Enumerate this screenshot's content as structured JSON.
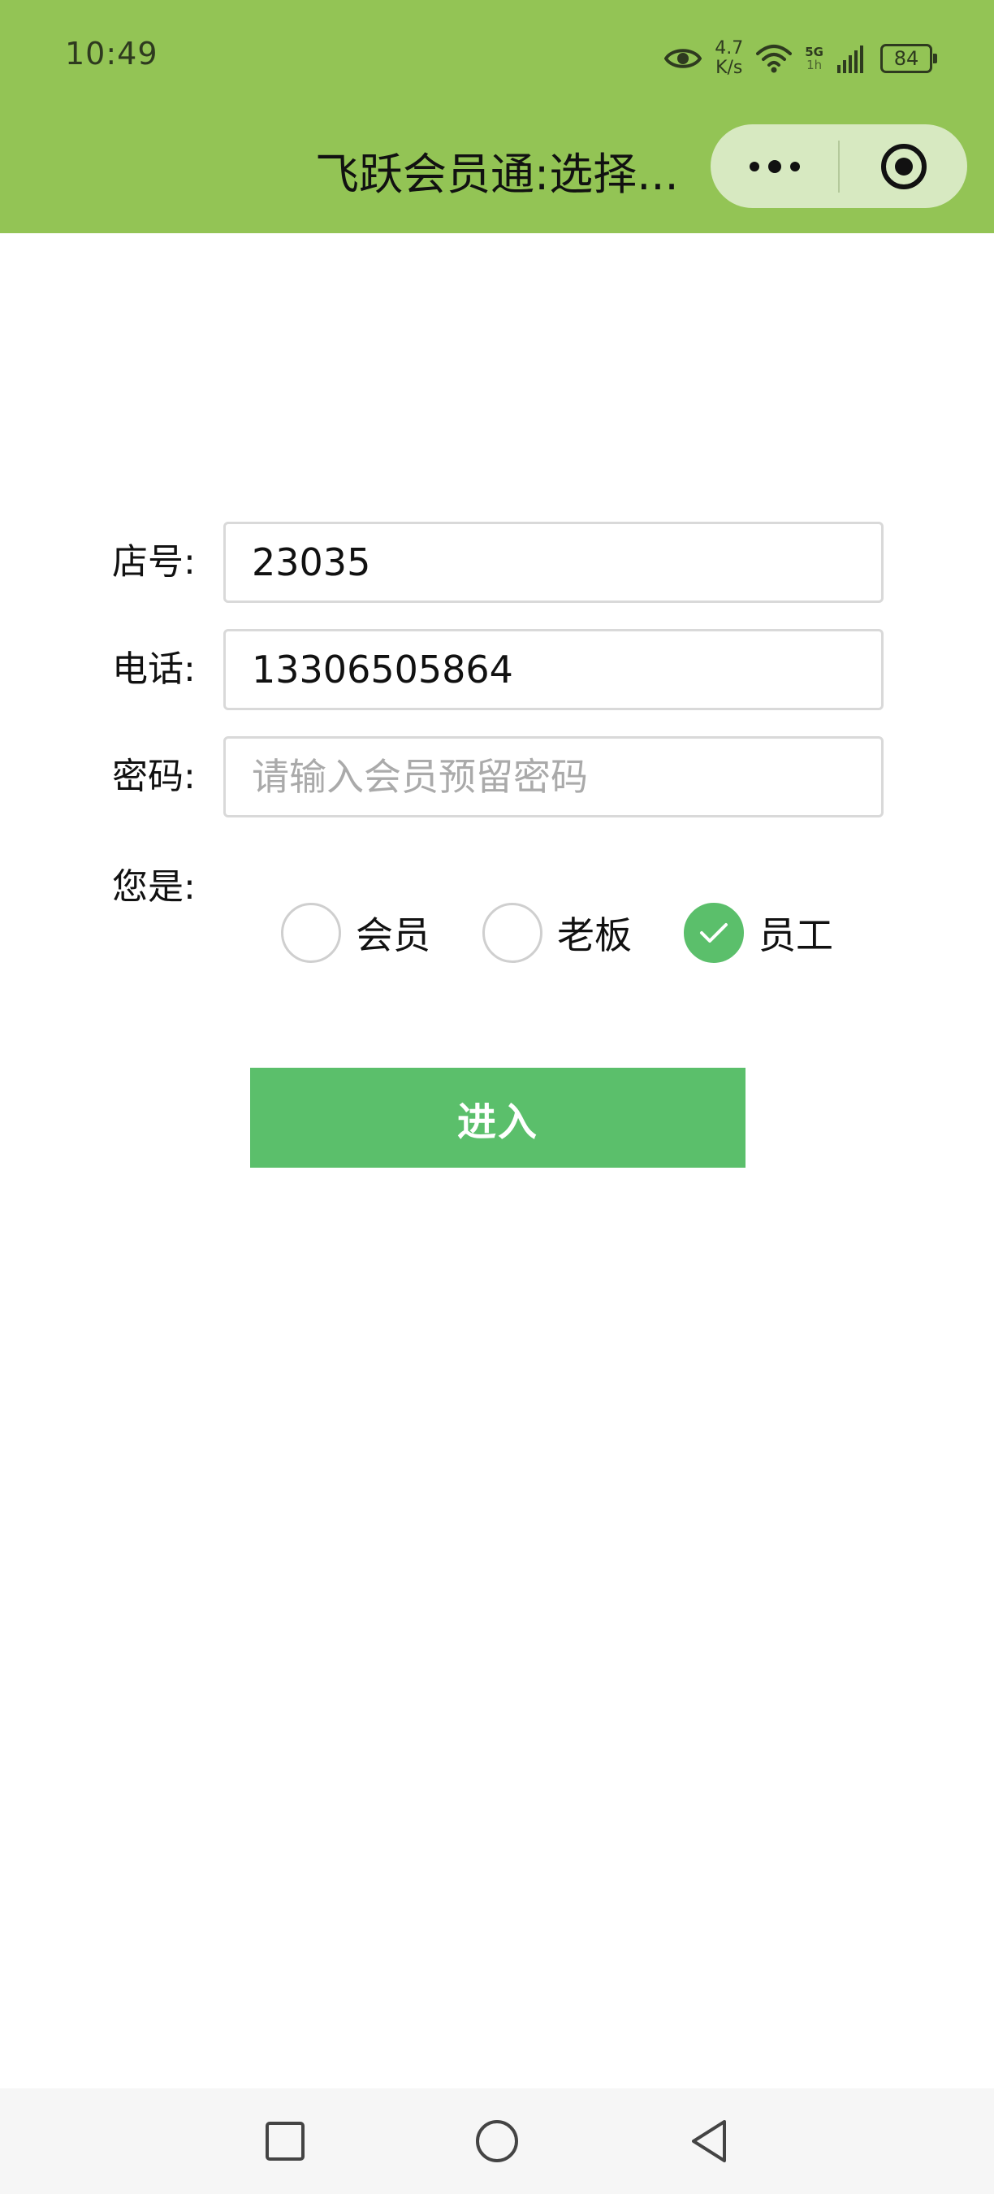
{
  "status_bar": {
    "time": "10:49",
    "net_speed_value": "4.7",
    "net_speed_unit": "K/s",
    "network_type": "5G",
    "network_sub": "1h",
    "battery": "84",
    "icons": [
      "eye-icon",
      "wifi-icon",
      "signal-icon",
      "battery-icon"
    ]
  },
  "header": {
    "title": "飞跃会员通:选择...",
    "background_color": "#93c455",
    "capsule_icons": [
      "more-dots-icon",
      "close-target-icon"
    ]
  },
  "form": {
    "store": {
      "label": "店号:",
      "value": "23035"
    },
    "phone": {
      "label": "电话:",
      "value": "13306505864"
    },
    "password": {
      "label": "密码:",
      "value": "",
      "placeholder": "请输入会员预留密码"
    },
    "role": {
      "label": "您是:",
      "options": [
        {
          "label": "会员",
          "checked": false
        },
        {
          "label": "老板",
          "checked": false
        },
        {
          "label": "员工",
          "checked": true
        }
      ]
    }
  },
  "enter_button": {
    "label": "进入",
    "color": "#5bbf6b"
  },
  "bottom_nav": {
    "icons": [
      "recent-apps-icon",
      "home-icon",
      "back-icon"
    ]
  }
}
